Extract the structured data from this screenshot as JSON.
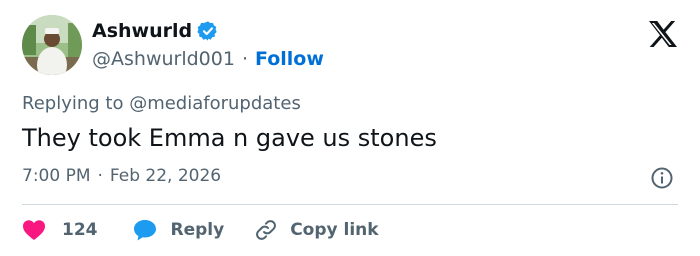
{
  "user": {
    "name": "Ashwurld",
    "handle": "@Ashwurld001",
    "separator": "·",
    "follow_label": "Follow"
  },
  "tweet": {
    "replying_to": "Replying to @mediaforupdates",
    "text": "They took Emma n gave us stones",
    "time": "7:00 PM",
    "separator": "·",
    "date": "Feb 22, 2026"
  },
  "actions": {
    "like_count": "124",
    "reply_label": "Reply",
    "copy_link_label": "Copy link"
  },
  "icons": {
    "logo": "x-logo-icon",
    "verified": "verified-badge-icon",
    "info": "info-icon",
    "like": "heart-icon",
    "reply": "speech-bubble-icon",
    "copy": "link-icon"
  },
  "colors": {
    "text": "#0f1419",
    "muted": "#536471",
    "follow": "#006fd6",
    "verified": "#1d9bf0",
    "like": "#f91880",
    "reply": "#1d9bf0",
    "divider": "#cfd9de"
  }
}
